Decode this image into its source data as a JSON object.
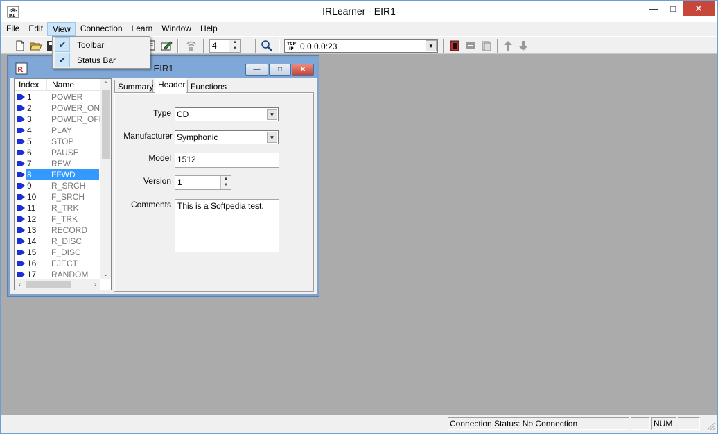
{
  "window": {
    "title": "IRLearner - EIR1"
  },
  "menubar": {
    "items": [
      "File",
      "Edit",
      "View",
      "Connection",
      "Learn",
      "Window",
      "Help"
    ],
    "active": "View"
  },
  "view_menu": {
    "items": [
      {
        "label": "Toolbar",
        "checked": true
      },
      {
        "label": "Status Bar",
        "checked": true
      }
    ]
  },
  "toolbar": {
    "spin_value": "4",
    "host_value": "0.0.0.0:23",
    "host_badge": "TCP\nIP"
  },
  "child": {
    "title": "EIR1",
    "list": {
      "headers": [
        "Index",
        "Name"
      ],
      "selected_index": 7,
      "rows": [
        {
          "index": "1",
          "name": "POWER"
        },
        {
          "index": "2",
          "name": "POWER_ON"
        },
        {
          "index": "3",
          "name": "POWER_OFF"
        },
        {
          "index": "4",
          "name": "PLAY"
        },
        {
          "index": "5",
          "name": "STOP"
        },
        {
          "index": "6",
          "name": "PAUSE"
        },
        {
          "index": "7",
          "name": "REW"
        },
        {
          "index": "8",
          "name": "FFWD"
        },
        {
          "index": "9",
          "name": "R_SRCH"
        },
        {
          "index": "10",
          "name": "F_SRCH"
        },
        {
          "index": "11",
          "name": "R_TRK"
        },
        {
          "index": "12",
          "name": "F_TRK"
        },
        {
          "index": "13",
          "name": "RECORD"
        },
        {
          "index": "14",
          "name": "R_DISC"
        },
        {
          "index": "15",
          "name": "F_DISC"
        },
        {
          "index": "16",
          "name": "EJECT"
        },
        {
          "index": "17",
          "name": "RANDOM"
        }
      ]
    },
    "tabs": [
      "Summary",
      "Header",
      "Functions"
    ],
    "active_tab": "Header",
    "form": {
      "type_label": "Type",
      "type_value": "CD",
      "manufacturer_label": "Manufacturer",
      "manufacturer_value": "Symphonic",
      "model_label": "Model",
      "model_value": "1512",
      "version_label": "Version",
      "version_value": "1",
      "comments_label": "Comments",
      "comments_value": "This is a Softpedia test."
    }
  },
  "statusbar": {
    "connection": "Connection Status: No Connection",
    "num": "NUM"
  },
  "colors": {
    "selection": "#3399ff",
    "close": "#c7483b",
    "mdi_bg": "#ababab",
    "arrow_icon": "#1b2fd6"
  }
}
